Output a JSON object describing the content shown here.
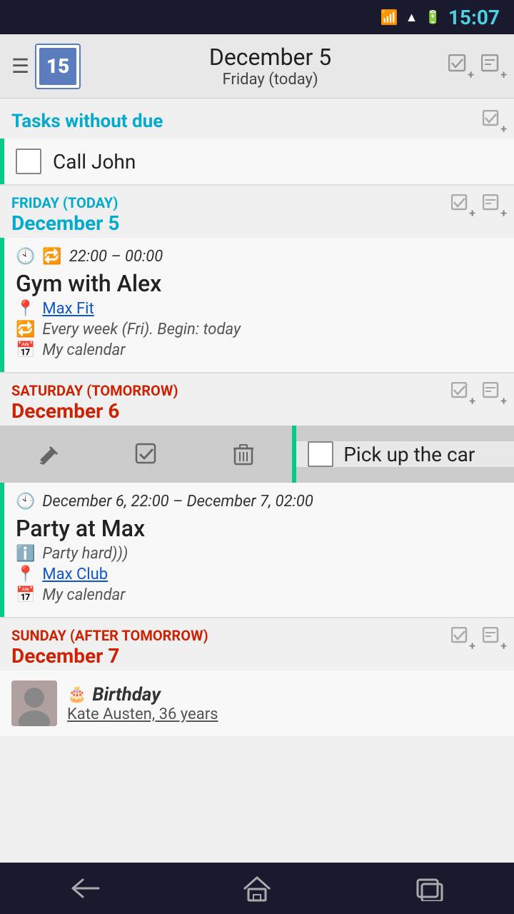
{
  "statusBar": {
    "time": "15:07",
    "wifiIcon": "wifi",
    "signalIcon": "signal",
    "batteryIcon": "battery"
  },
  "header": {
    "menuLabel": "☰",
    "logoNumber": "15",
    "date": "December 5",
    "day": "Friday (today)",
    "addTaskLabel": "✚",
    "addNoteLabel": "✚"
  },
  "sections": {
    "tasksWithoutDue": {
      "title": "Tasks without due",
      "items": [
        {
          "label": "Call John",
          "checked": false
        }
      ]
    },
    "friday": {
      "dayLabel": "FRIDAY (TODAY)",
      "dateLabel": "December 5",
      "events": [
        {
          "timeIcon": "🕙",
          "repeatIcon": "🔁",
          "time": "22:00 – 00:00",
          "title": "Gym with Alex",
          "location": "Max Fit",
          "repeat": "Every week (Fri). Begin: today",
          "calendar": "My calendar"
        }
      ]
    },
    "saturday": {
      "dayLabel": "SATURDAY (TOMORROW)",
      "dateLabel": "December 6",
      "swipeTask": {
        "label": "Pick up the car",
        "checked": false
      },
      "events": [
        {
          "time": "December 6, 22:00 – December 7, 02:00",
          "title": "Party at Max",
          "info": "Party hard)))",
          "location": "Max Club",
          "calendar": "My calendar"
        }
      ]
    },
    "sunday": {
      "dayLabel": "SUNDAY (AFTER TOMORROW)",
      "dateLabel": "December 7",
      "birthday": {
        "title": "Birthday",
        "personName": "Kate Austen, 36 years"
      }
    }
  },
  "bottomNav": {
    "backIcon": "←",
    "homeIcon": "⌂",
    "recentIcon": "▭"
  }
}
